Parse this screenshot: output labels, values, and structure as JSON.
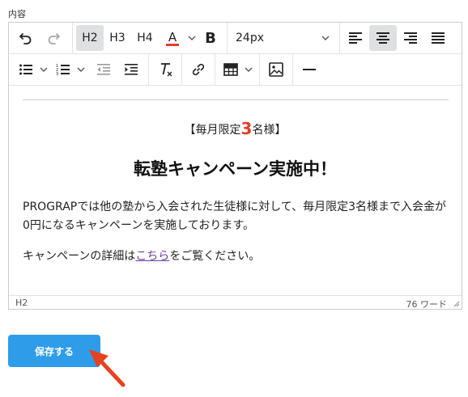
{
  "field": {
    "label": "内容"
  },
  "toolbar": {
    "heading_buttons": [
      "H2",
      "H3",
      "H4"
    ],
    "font_size": "24px",
    "text_color": "#e03e2d"
  },
  "content": {
    "promo_prefix": "【毎月限定",
    "promo_number": "3",
    "promo_suffix": "名様】",
    "headline": "転塾キャンペーン実施中！",
    "paragraph1": "PROGRAPでは他の塾から入会された生徒様に対して、毎月限定3名様まで入会金が0円になるキャンペーンを実施しております。",
    "paragraph2_prefix": "キャンペーンの詳細は",
    "paragraph2_link": "こちら",
    "paragraph2_suffix": "をご覧ください。"
  },
  "statusbar": {
    "path": "H2",
    "word_count": "76 ワード"
  },
  "actions": {
    "save_label": "保存する"
  },
  "colors": {
    "accent": "#2f9ce9",
    "annotation_arrow": "#e8411f",
    "highlight_number": "#e03e2d"
  }
}
